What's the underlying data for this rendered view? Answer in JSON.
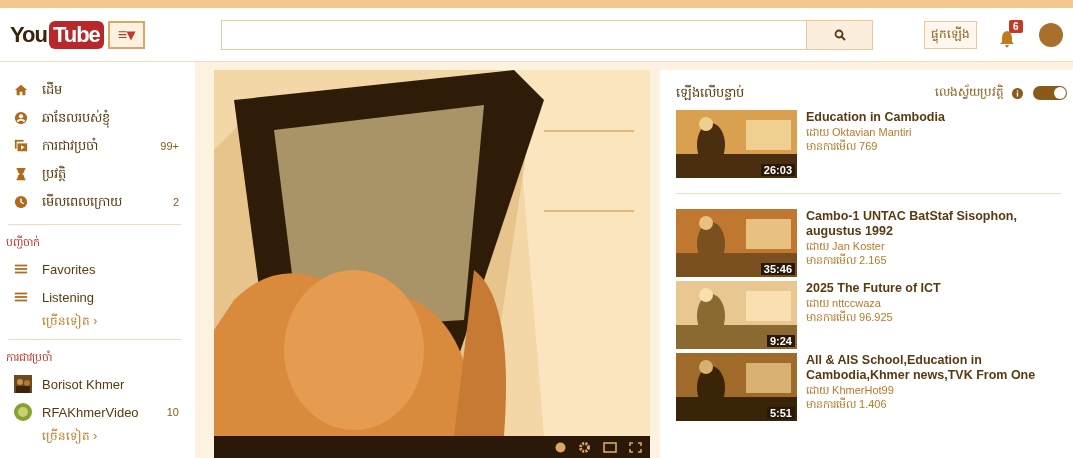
{
  "header": {
    "logo": {
      "part_1": "You",
      "part_2": "Tube"
    },
    "menu_button": "≡▾",
    "upload_button": "ផ្ទុកឡើង",
    "notification_count": "6"
  },
  "sidebar": {
    "items": [
      {
        "label": "ដើម"
      },
      {
        "label": "ឆានែលរបស់ខ្ញុំ"
      },
      {
        "label": "ការជាវប្រចាំ",
        "count": "99+"
      },
      {
        "label": "ប្រវត្តិ"
      },
      {
        "label": "មើលពេលក្រោយ",
        "count": "2"
      }
    ],
    "playlists": {
      "heading": "បញ្ជីចាក់",
      "items": [
        {
          "label": "Favorites"
        },
        {
          "label": "Listening"
        }
      ],
      "more": "ច្រើនទៀត ›"
    },
    "subscriptions": {
      "heading": "ការជាវប្រចាំ",
      "items": [
        {
          "label": "Borisot Khmer"
        },
        {
          "label": "RFAKhmerVideo",
          "count": "10"
        }
      ],
      "more": "ច្រើនទៀត ›"
    }
  },
  "up_next": {
    "heading": "ឡើងលើបន្ទាប់",
    "autoplay": {
      "label": "លេងស្វ័យប្រវត្តិ",
      "on": true
    },
    "videos": [
      {
        "title": "Education in Cambodia",
        "channel": "ដោយ Oktavian Mantiri",
        "views": "មានការមើល 769",
        "duration": "26:03"
      },
      {
        "title": "Cambo-1 UNTAC BatStaf Sisophon, augustus 1992",
        "channel": "ដោយ Jan Koster",
        "views": "មានការមើល 2.165",
        "duration": "35:46"
      },
      {
        "title": "2025 The Future of ICT",
        "channel": "ដោយ nttccwaza",
        "views": "មានការមើល 96.925",
        "duration": "9:24"
      },
      {
        "title": "All & AIS School,Education in Cambodia,Khmer news,TVK From One",
        "channel": "ដោយ KhmerHot99",
        "views": "មានការមើល 1.406",
        "duration": "5:51"
      }
    ]
  }
}
